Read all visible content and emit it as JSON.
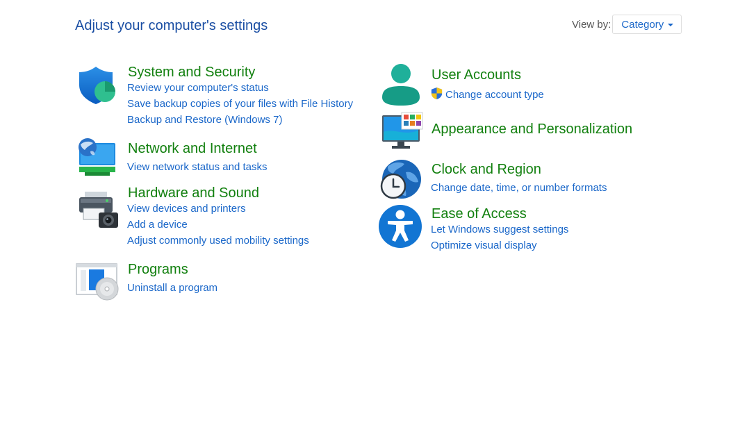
{
  "page": {
    "title": "Adjust your computer's settings",
    "view_by_label": "View by:",
    "view_by_value": "Category"
  },
  "left_categories": [
    {
      "title": "System and Security",
      "icon": "security-shield-icon",
      "links": [
        "Review your computer's status",
        "Save backup copies of your files with File History",
        "Backup and Restore (Windows 7)"
      ]
    },
    {
      "title": "Network and Internet",
      "icon": "network-globe-monitor-icon",
      "links": [
        "View network status and tasks"
      ]
    },
    {
      "title": "Hardware and Sound",
      "icon": "printer-camera-icon",
      "links": [
        "View devices and printers",
        "Add a device",
        "Adjust commonly used mobility settings"
      ]
    },
    {
      "title": "Programs",
      "icon": "program-disc-icon",
      "links": [
        "Uninstall a program"
      ]
    }
  ],
  "right_categories": [
    {
      "title": "User Accounts",
      "icon": "user-icon",
      "links": [
        "Change account type"
      ],
      "link_icon": "uac-shield-icon"
    },
    {
      "title": "Appearance and Personalization",
      "icon": "monitor-tiles-icon",
      "links": []
    },
    {
      "title": "Clock and Region",
      "icon": "globe-clock-icon",
      "links": [
        "Change date, time, or number formats"
      ]
    },
    {
      "title": "Ease of Access",
      "icon": "accessibility-icon",
      "links": [
        "Let Windows suggest settings",
        "Optimize visual display"
      ]
    }
  ],
  "colors": {
    "title_blue": "#1a4ea3",
    "category_green": "#12800f",
    "link_blue": "#1a67c9"
  }
}
